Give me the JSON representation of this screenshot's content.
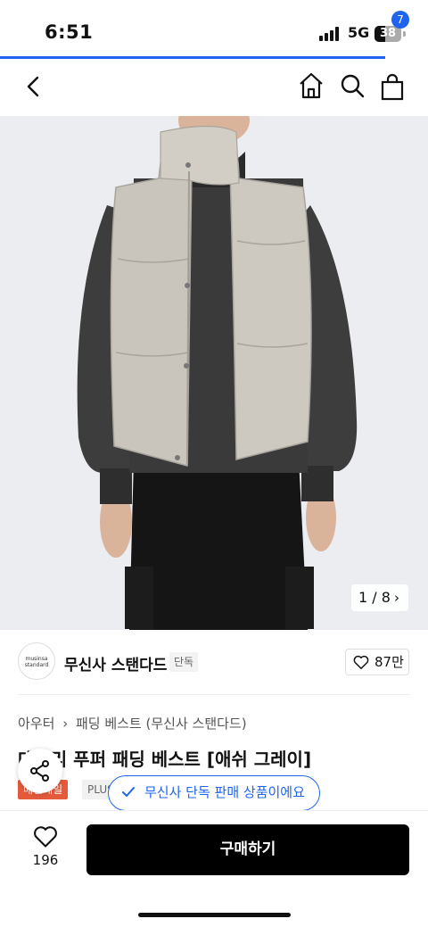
{
  "status_bar": {
    "time": "6:51",
    "network": "5G",
    "battery_level": "38"
  },
  "loading": {
    "progress": 0.9
  },
  "top_nav": {
    "cart_count": "7"
  },
  "product_image": {
    "counter": "1 / 8"
  },
  "brand": {
    "logo_text_line1": "musinsa",
    "logo_text_line2": "standard",
    "name": "무신사 스탠다드",
    "exclusive_tag": "단독",
    "like_count": "87만"
  },
  "breadcrumb": {
    "items": [
      "아우터",
      "패딩 베스트 (무신사 스탠다드)"
    ]
  },
  "product": {
    "title": "데일리 푸퍼 패딩 베스트 [애쉬 그레이]",
    "tags": [
      "매진세일",
      "PLUS"
    ]
  },
  "toast": {
    "text": "무신사 단독 판매 상품이에요"
  },
  "bottom_bar": {
    "like_count": "196",
    "buy_label": "구매하기"
  },
  "colors": {
    "accent": "#1e64f0",
    "sale": "#e65a3c",
    "vest": "#c9c5bd",
    "sweater": "#3d3d3d"
  }
}
